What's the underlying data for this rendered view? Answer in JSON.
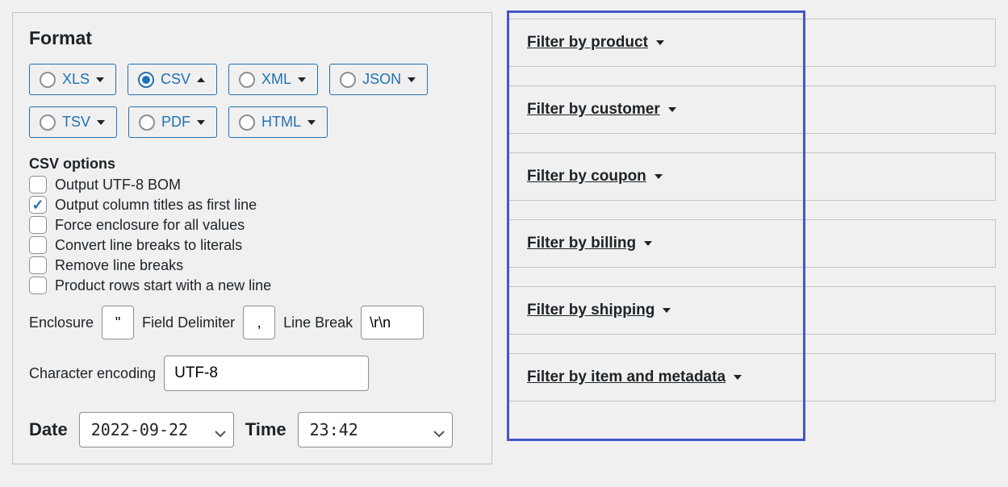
{
  "format": {
    "heading": "Format",
    "options": [
      {
        "id": "xls",
        "label": "XLS",
        "selected": false,
        "caret": "down"
      },
      {
        "id": "csv",
        "label": "CSV",
        "selected": true,
        "caret": "up"
      },
      {
        "id": "xml",
        "label": "XML",
        "selected": false,
        "caret": "down"
      },
      {
        "id": "json",
        "label": "JSON",
        "selected": false,
        "caret": "down"
      },
      {
        "id": "tsv",
        "label": "TSV",
        "selected": false,
        "caret": "down"
      },
      {
        "id": "pdf",
        "label": "PDF",
        "selected": false,
        "caret": "down"
      },
      {
        "id": "html",
        "label": "HTML",
        "selected": false,
        "caret": "down"
      }
    ]
  },
  "csv_options": {
    "heading": "CSV options",
    "checkboxes": [
      {
        "id": "bom",
        "label": "Output UTF-8 BOM",
        "checked": false
      },
      {
        "id": "titles",
        "label": "Output column titles as first line",
        "checked": true
      },
      {
        "id": "enclosure",
        "label": "Force enclosure for all values",
        "checked": false
      },
      {
        "id": "convert_lb",
        "label": "Convert line breaks to literals",
        "checked": false
      },
      {
        "id": "remove_lb",
        "label": "Remove line breaks",
        "checked": false
      },
      {
        "id": "product_rows",
        "label": "Product rows start with a new line",
        "checked": false
      }
    ],
    "enclosure_label": "Enclosure",
    "enclosure_value": "\"",
    "delimiter_label": "Field Delimiter",
    "delimiter_value": ",",
    "linebreak_label": "Line Break",
    "linebreak_value": "\\r\\n",
    "encoding_label": "Character encoding",
    "encoding_value": "UTF-8"
  },
  "datetime": {
    "date_label": "Date",
    "date_value": "2022-09-22",
    "time_label": "Time",
    "time_value": "23:42"
  },
  "filters": [
    {
      "id": "product",
      "label": "Filter by product "
    },
    {
      "id": "customer",
      "label": "Filter by customer "
    },
    {
      "id": "coupon",
      "label": "Filter by coupon "
    },
    {
      "id": "billing",
      "label": "Filter by billing "
    },
    {
      "id": "shipping",
      "label": "Filter by shipping "
    },
    {
      "id": "metadata",
      "label": "Filter by item and metadata "
    }
  ]
}
